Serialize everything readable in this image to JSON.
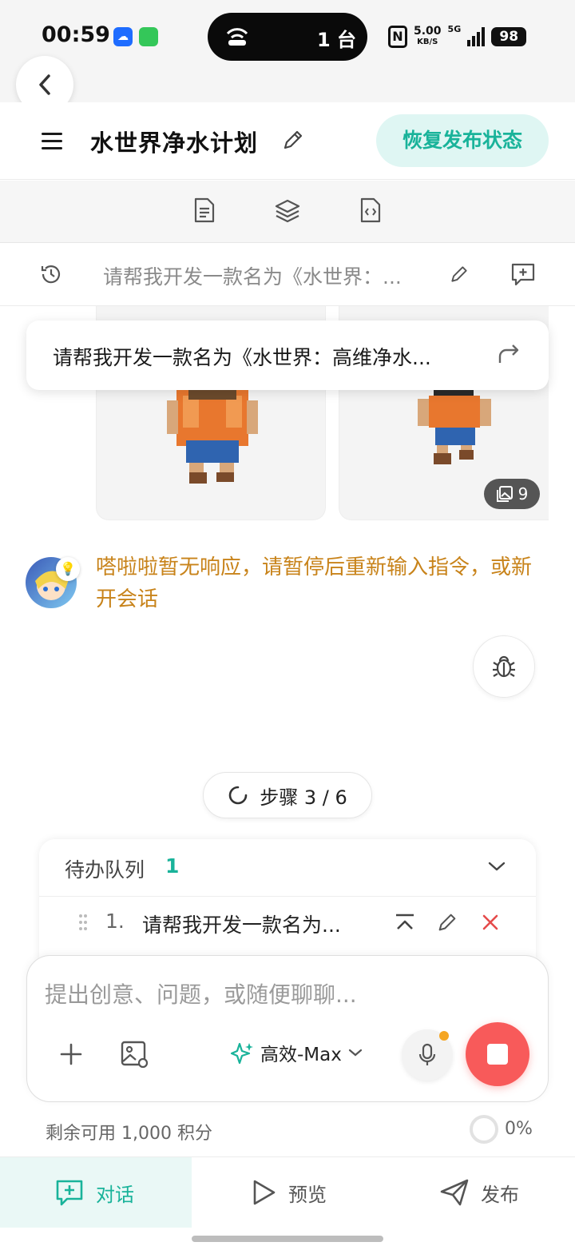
{
  "status_bar": {
    "time": "00:59",
    "island_text": "1 台",
    "speed_top": "5.00",
    "speed_unit": "KB/S",
    "network": "5G",
    "battery": "98"
  },
  "header": {
    "title": "水世界净水计划",
    "restore_button": "恢复发布状态"
  },
  "prompt_bar": {
    "text": "请帮我开发一款名为《水世界：..."
  },
  "popup": {
    "text": "请帮我开发一款名为《水世界：高维净水..."
  },
  "image_badge": {
    "count": "9"
  },
  "assistant_message": {
    "text": "嗒啦啦暂无响应，请暂停后重新输入指令，或新开会话"
  },
  "step": {
    "label": "步骤 3 / 6"
  },
  "queue": {
    "title": "待办队列",
    "count": "1",
    "items": [
      {
        "num": "1.",
        "text": "请帮我开发一款名为..."
      }
    ]
  },
  "input": {
    "placeholder": "提出创意、问题，或随便聊聊...",
    "model": "高效-Max"
  },
  "credits": {
    "text": "剩余可用 1,000 积分",
    "percent": "0%"
  },
  "bottom_nav": {
    "items": [
      {
        "label": "对话",
        "active": true
      },
      {
        "label": "预览",
        "active": false
      },
      {
        "label": "发布",
        "active": false
      }
    ]
  },
  "colors": {
    "accent": "#19b39a",
    "warning_text": "#c8831a",
    "stop": "#f85a5a"
  }
}
